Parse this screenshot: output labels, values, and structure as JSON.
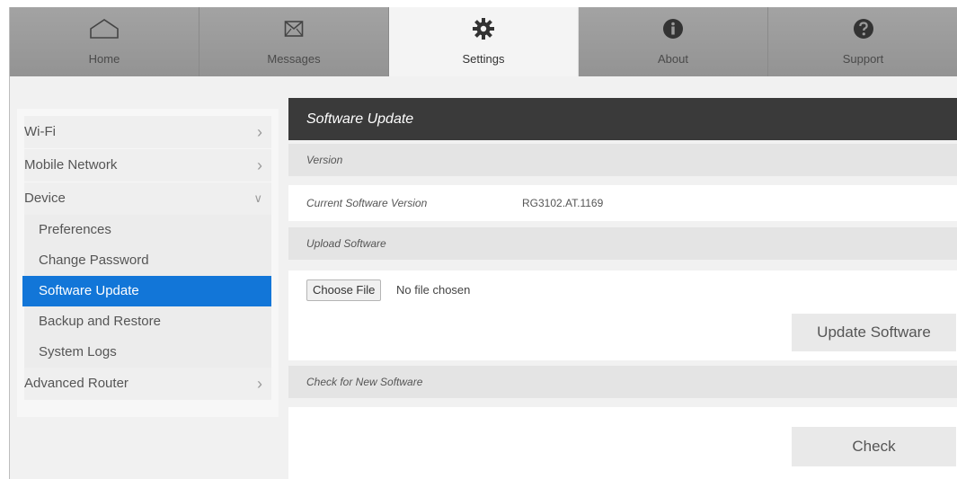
{
  "nav": {
    "tabs": [
      {
        "label": "Home",
        "icon": "home-icon"
      },
      {
        "label": "Messages",
        "icon": "envelope-icon"
      },
      {
        "label": "Settings",
        "icon": "gear-icon",
        "active": true
      },
      {
        "label": "About",
        "icon": "info-icon"
      },
      {
        "label": "Support",
        "icon": "question-icon"
      }
    ]
  },
  "sidebar": {
    "wifi": "Wi-Fi",
    "mobile_network": "Mobile Network",
    "device": "Device",
    "device_items": [
      "Preferences",
      "Change Password",
      "Software Update",
      "Backup and Restore",
      "System Logs"
    ],
    "selected": "Software Update",
    "advanced_router": "Advanced Router"
  },
  "main": {
    "title": "Software Update",
    "version_section": "Version",
    "current_version_label": "Current Software Version",
    "current_version_value": "RG3102.AT.1169",
    "upload_section": "Upload Software",
    "choose_file_label": "Choose File",
    "no_file_text": "No file chosen",
    "update_button": "Update Software",
    "check_section": "Check for New Software",
    "check_button": "Check"
  },
  "colors": {
    "accent": "#1276d8",
    "header_bg": "#3a3a3a",
    "nav_bg": "#9b9b9b"
  }
}
